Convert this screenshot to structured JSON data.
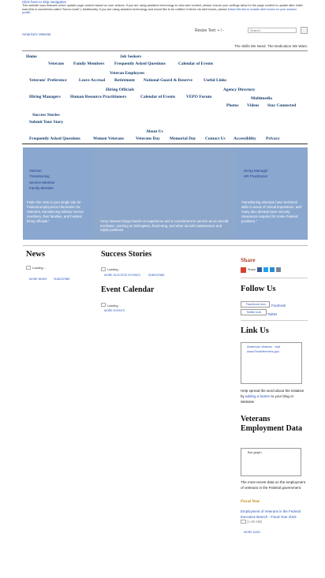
{
  "top": {
    "skip_link": "Click here to skip navigation",
    "notice_text": "This website uses features which update page content based on user actions. If you are using assistive technology to view web content, please ensure your settings allow for the page content to update after initial load (this is sometimes called \"forms mode\"). Additionally, if you are using assistive technology and would like to be notified of items via alert boxes, please",
    "notice_link": "follow this link to enable alert boxes for your session profile."
  },
  "header": {
    "brand": "America's Veteran",
    "resize_label": "Resize Text:",
    "resize_plus": "+",
    "resize_sep": " / ",
    "resize_minus": "-",
    "search_placeholder": "Search...",
    "tagline": "The Skills We Need. The Dedication We Want."
  },
  "nav": {
    "home": "Home",
    "job_seekers": "Job Seekers",
    "veterans": "Veterans",
    "family_members": "Family Members",
    "faq": "Frequently Asked Questions",
    "calendar": "Calendar of Events",
    "veteran_employees": "Veteran Employees",
    "veterans_preference": "Veterans' Preference",
    "leave_accrual": "Leave Accrual",
    "retirement": "Retirement",
    "national_guard": "National Guard & Reserve",
    "useful_links": "Useful Links",
    "hiring_officials": "Hiring Officials",
    "agency_directory": "Agency Directory",
    "hiring_managers": "Hiring Managers",
    "hr_practitioners": "Human Resource Practitioners",
    "calendar2": "Calendar of Events",
    "vepo_forum": "VEPO Forum",
    "multimedia": "Multimedia",
    "photos": "Photos",
    "videos": "Videos",
    "stay_connected": "Stay Connected",
    "success_stories": "Success Stories",
    "submit_story": "Submit Your Story",
    "about_us": "About Us",
    "faq2": "Frequently Asked Questions",
    "women_veterans": "Women Veterans",
    "veterans_day": "Veterans Day",
    "memorial_day": "Memorial Day",
    "contact_us": "Contact Us",
    "accessibility": "Accessibility",
    "privacy": "Privacy"
  },
  "hero": {
    "left_items": [
      "Veteran",
      "Transitioning",
      "Service Member",
      "Family Member"
    ],
    "left_text": "Feds Hire Vets is your single site for Federal employment information for Veterans, transitioning military service members, their families, and Federal hiring officials.\"",
    "center_text": "Army Veteran brings hands-on experience and a commitment to service as an aircraft mechanic, working on helicopters, fixed wing, and other aircraft maintenance and repair positions.",
    "right_items": [
      "Hiring Manager",
      "HR Practitioner"
    ],
    "right_text": "Transitioning veterans have technical skills in areas of critical importance, and many also already have security clearances required for some Federal positions.\""
  },
  "news": {
    "title": "News",
    "loading": "Loading...",
    "more": "MORE NEWS",
    "subscribe": "SUBSCRIBE"
  },
  "success": {
    "title": "Success Stories",
    "loading": "Loading...",
    "more": "MORE SUCCESS STORIES",
    "subscribe": "SUBSCRIBE"
  },
  "events": {
    "title": "Event Calendar",
    "loading": "Loading...",
    "more": "MORE EVENTS"
  },
  "sidebar": {
    "share_title": "Share",
    "share_label": "Share",
    "follow_title": "Follow Us",
    "facebook_icon_alt": "Facebook icon",
    "facebook": "Facebook",
    "twitter_icon_alt": "Twitter icon",
    "twitter": "Twitter",
    "link_title": "Link Us",
    "link_box_text": "American Veteran - visit www.FedsHireVets.gov",
    "help_pre": "Help spread the word about the initiative by",
    "help_link": "adding a button",
    "help_post": "to your blog or Website!",
    "data_title": "Veterans Employment Data",
    "bar_graph_alt": "Bar graph",
    "data_text": "The most recent data on the employment of veterans in the Federal government.",
    "fy_title": "Fiscal Year",
    "report_link": "Employment of Veterans in the Federal Executive Branch - Fiscal Year 2015",
    "report_size": "[1.69 MB]",
    "more_data": "MORE DATA"
  },
  "colors": {
    "panel": "#8aa7cf",
    "nav_text": "#123b6d",
    "link": "#2a55b8",
    "share": "#b5432b",
    "fiscal": "#c08a1a"
  }
}
